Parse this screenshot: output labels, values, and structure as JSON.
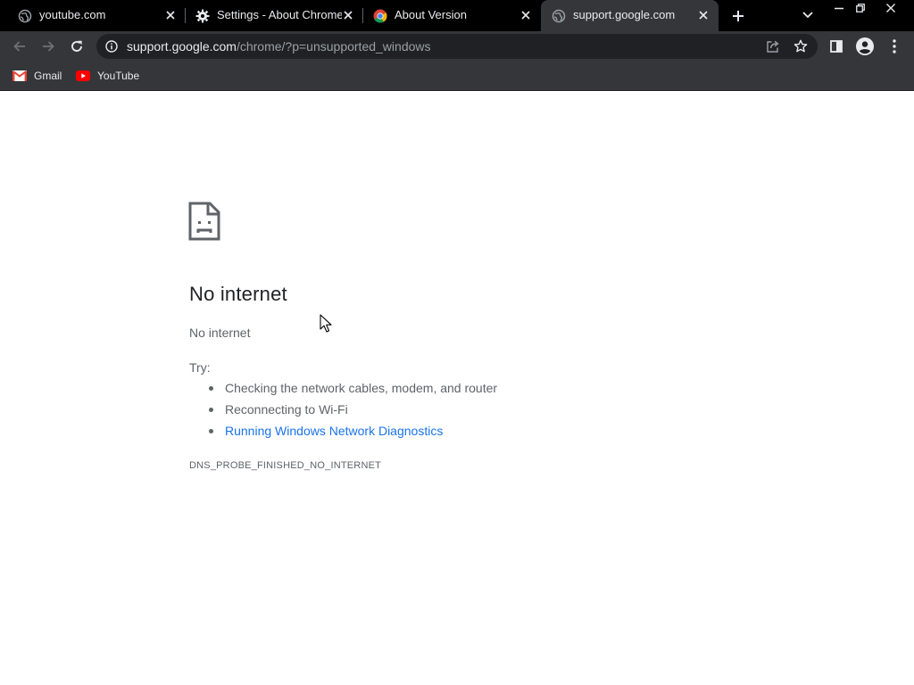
{
  "browser": {
    "tabs": [
      {
        "title": "youtube.com",
        "icon": "globe-icon",
        "active": false
      },
      {
        "title": "Settings - About Chrome",
        "icon": "gear-icon",
        "active": false
      },
      {
        "title": "About Version",
        "icon": "chrome-logo-icon",
        "active": false
      },
      {
        "title": "support.google.com",
        "icon": "globe-icon",
        "active": true
      }
    ],
    "omnibox": {
      "host": "support.google.com",
      "path": "/chrome/?p=unsupported_windows"
    },
    "bookmarks": [
      {
        "label": "Gmail",
        "icon": "gmail-icon"
      },
      {
        "label": "YouTube",
        "icon": "youtube-icon"
      }
    ]
  },
  "page": {
    "title": "No internet",
    "subtitle": "No internet",
    "try_label": "Try:",
    "suggestions": [
      "Checking the network cables, modem, and router",
      "Reconnecting to Wi-Fi",
      "Running Windows Network Diagnostics"
    ],
    "error_code": "DNS_PROBE_FINISHED_NO_INTERNET"
  },
  "colors": {
    "tabstrip": "#000000",
    "toolbar": "#35363a",
    "omnibox": "#202124",
    "link": "#1a73e8",
    "text_secondary": "#5f6368"
  }
}
